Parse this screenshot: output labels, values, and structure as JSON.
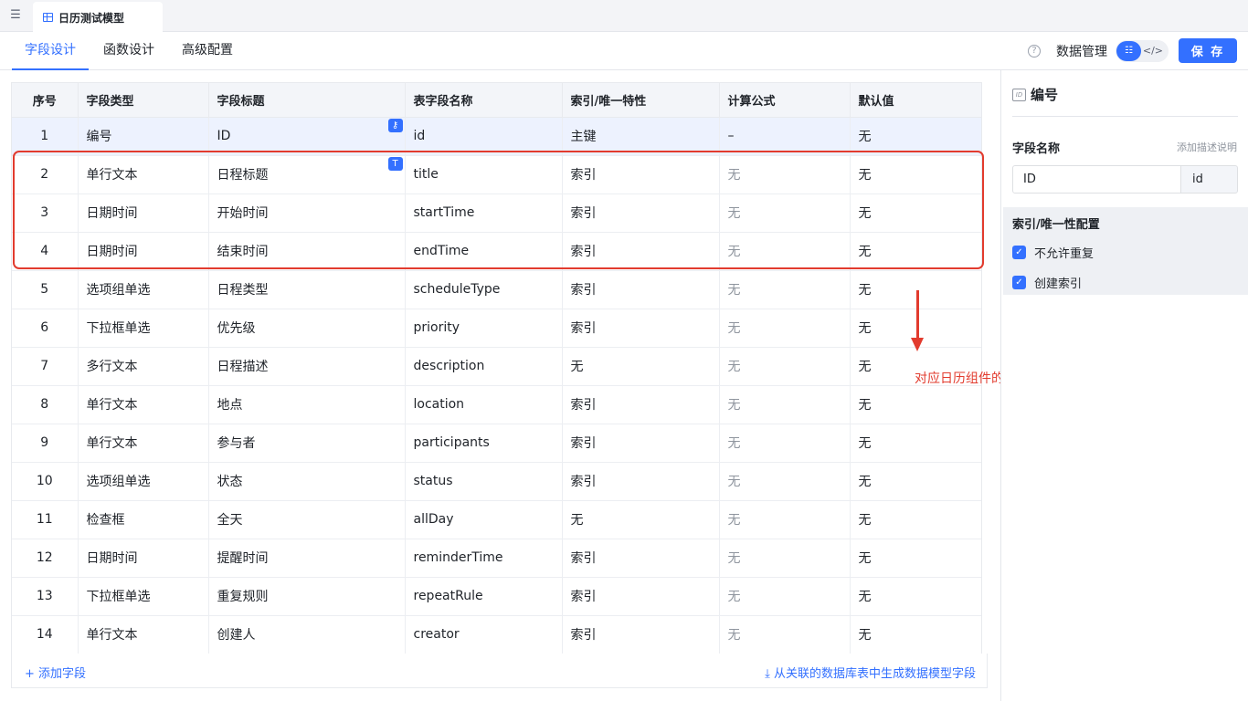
{
  "file_tab": {
    "title": "日历测试模型"
  },
  "nav": {
    "tabs": [
      {
        "label": "字段设计"
      },
      {
        "label": "函数设计"
      },
      {
        "label": "高级配置"
      }
    ]
  },
  "header": {
    "help_icon": "?",
    "data_management": "数据管理",
    "save": "保 存"
  },
  "table": {
    "headers": [
      "序号",
      "字段类型",
      "字段标题",
      "表字段名称",
      "索引/唯一特性",
      "计算公式",
      "默认值"
    ],
    "rows": [
      [
        "1",
        "编号",
        "ID",
        "id",
        "主键",
        "–",
        "无"
      ],
      [
        "2",
        "单行文本",
        "日程标题",
        "title",
        "索引",
        "无",
        "无"
      ],
      [
        "3",
        "日期时间",
        "开始时间",
        "startTime",
        "索引",
        "无",
        "无"
      ],
      [
        "4",
        "日期时间",
        "结束时间",
        "endTime",
        "索引",
        "无",
        "无"
      ],
      [
        "5",
        "选项组单选",
        "日程类型",
        "scheduleType",
        "索引",
        "无",
        "无"
      ],
      [
        "6",
        "下拉框单选",
        "优先级",
        "priority",
        "索引",
        "无",
        "无"
      ],
      [
        "7",
        "多行文本",
        "日程描述",
        "description",
        "无",
        "无",
        "无"
      ],
      [
        "8",
        "单行文本",
        "地点",
        "location",
        "索引",
        "无",
        "无"
      ],
      [
        "9",
        "单行文本",
        "参与者",
        "participants",
        "索引",
        "无",
        "无"
      ],
      [
        "10",
        "选项组单选",
        "状态",
        "status",
        "索引",
        "无",
        "无"
      ],
      [
        "11",
        "检查框",
        "全天",
        "allDay",
        "无",
        "无",
        "无"
      ],
      [
        "12",
        "日期时间",
        "提醒时间",
        "reminderTime",
        "索引",
        "无",
        "无"
      ],
      [
        "13",
        "下拉框单选",
        "重复规则",
        "repeatRule",
        "索引",
        "无",
        "无"
      ],
      [
        "14",
        "单行文本",
        "创建人",
        "creator",
        "索引",
        "无",
        "无"
      ]
    ]
  },
  "annotation": "对应日历组件的基本字段映射",
  "bottom": {
    "add_field": "+ 添加字段",
    "generate": "⤓ 从关联的数据库表中生成数据模型字段"
  },
  "right_panel": {
    "title": "编号",
    "id_icon": "ID",
    "field_name_label": "字段名称",
    "add_description": "添加描述说明",
    "title_value": "ID",
    "name_value": "id",
    "index_section": "索引/唯一性配置",
    "checkboxes": [
      {
        "label": "不允许重复",
        "checked": true
      },
      {
        "label": "创建索引",
        "checked": true
      }
    ]
  },
  "colors": {
    "accent": "#3370ff",
    "annotation": "#e23b2e",
    "selected_row": "#edf2fe"
  }
}
